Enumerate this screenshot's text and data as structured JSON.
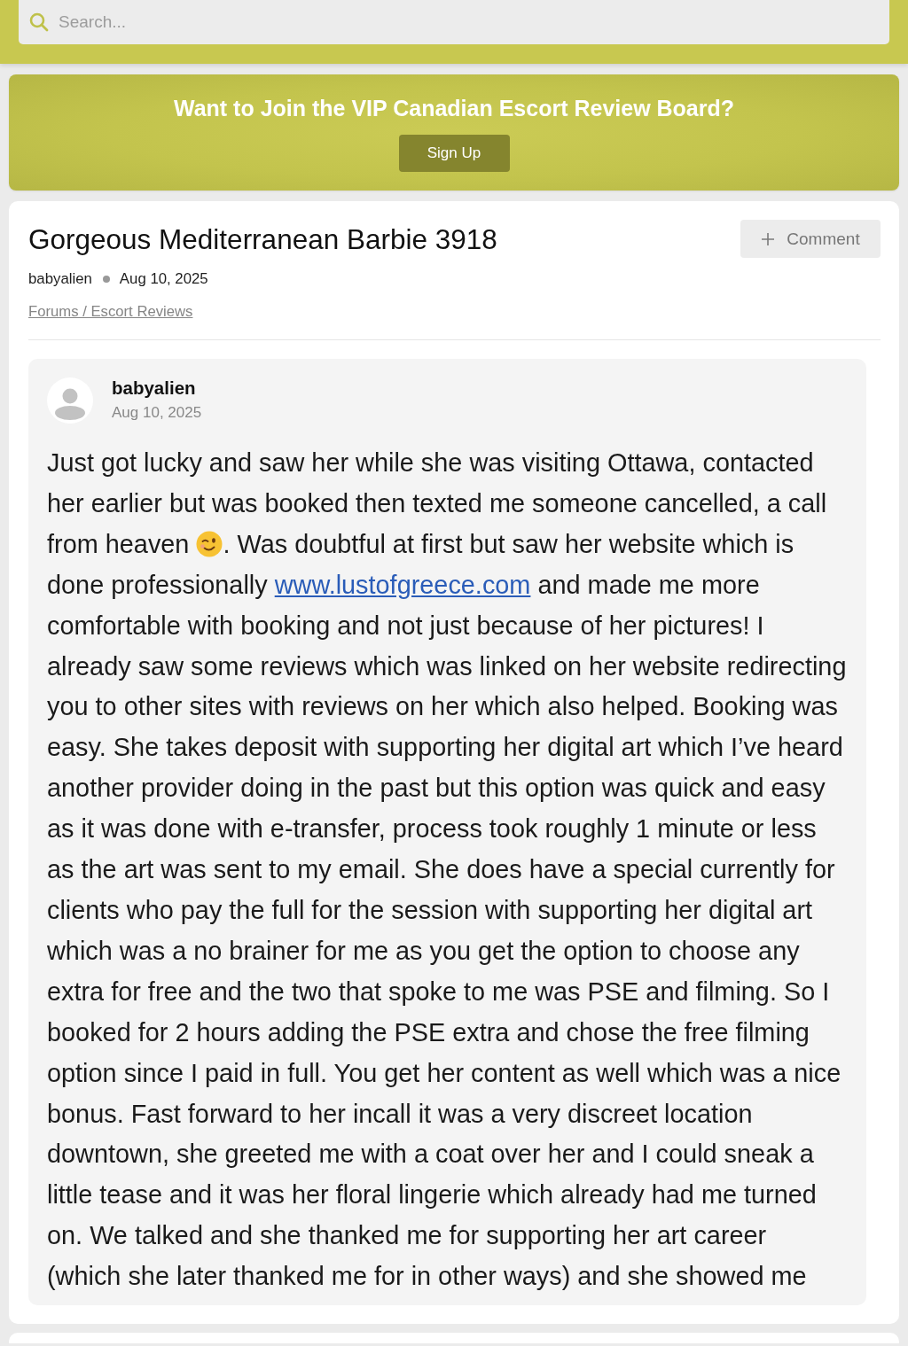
{
  "search": {
    "placeholder": "Search..."
  },
  "banner": {
    "title": "Want to Join the VIP Canadian Escort Review Board?",
    "button": "Sign Up"
  },
  "thread": {
    "title": "Gorgeous Mediterranean Barbie 3918",
    "comment_button": "Comment",
    "author": "babyalien",
    "date": "Aug 10, 2025",
    "breadcrumb": "Forums / Escort Reviews"
  },
  "posts": [
    {
      "author": "babyalien",
      "date": "Aug 10, 2025",
      "body": [
        {
          "kind": "text",
          "text": "Just got lucky and saw her while she was visiting Ottawa, contacted her earlier but was booked then texted me someone cancelled, a call from heaven "
        },
        {
          "kind": "emoji"
        },
        {
          "kind": "text",
          "text": ". Was doubtful at first but saw her website which is done professionally "
        },
        {
          "kind": "link",
          "text": "www.lustofgreece.com"
        },
        {
          "kind": "text",
          "text": " and made me more comfortable with booking and not just because of her pictures! I already saw some reviews which was linked on her website redirecting you to other sites with reviews on her which also helped. Booking was easy. She takes deposit with supporting her digital art which I’ve heard another provider doing in the past but this option was quick and easy as it was done with e-transfer, process took roughly 1 minute or less as the art was sent to my email. She does have a special currently for clients who pay the full for the session with supporting her digital art which was a no brainer for me as you get the option to choose any extra for free and the two that spoke to me was PSE and filming. So I booked for 2 hours adding the PSE extra and chose the free filming option since I paid in full. You get her content as well which was a nice bonus. Fast forward to her incall it was a very discreet location downtown, she greeted me with a coat over her and I could sneak a little tease and it was her floral lingerie which already had me turned on. We talked and she thanked me for supporting her art career (which she later thanked me for in other ways) and she showed me"
        }
      ]
    }
  ]
}
